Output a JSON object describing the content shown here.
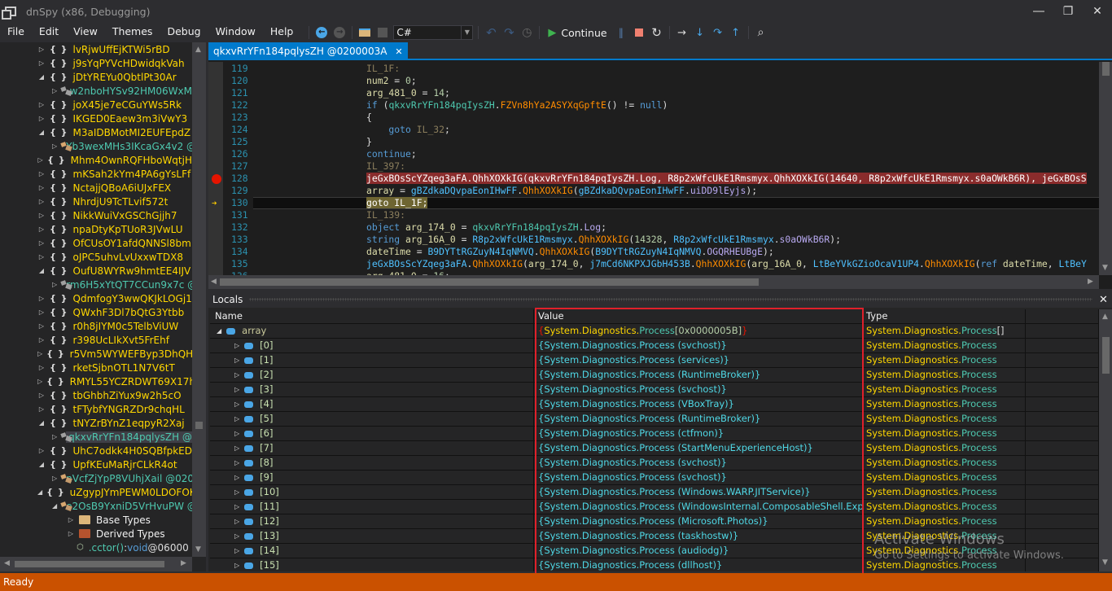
{
  "window": {
    "title": "dnSpy (x86, Debugging)",
    "controls": [
      "minimize",
      "restore",
      "close"
    ]
  },
  "menu": [
    "File",
    "Edit",
    "View",
    "Themes",
    "Debug",
    "Window",
    "Help"
  ],
  "toolbar": {
    "language": "C#",
    "continue_label": "Continue"
  },
  "tree": {
    "rows": [
      {
        "depth": 0,
        "kind": "ns",
        "expanded": false,
        "label": "lvRjwUffEjKTWi5rBD"
      },
      {
        "depth": 0,
        "kind": "ns",
        "expanded": false,
        "label": "j9sYqPYVcHDwidqkVah"
      },
      {
        "depth": 0,
        "kind": "ns",
        "expanded": true,
        "label": "jDtYREYu0QbtlPt30Ar"
      },
      {
        "depth": 1,
        "kind": "cls-gray",
        "expanded": false,
        "label": "w2nboHYSv92HM06WxM"
      },
      {
        "depth": 0,
        "kind": "ns",
        "expanded": false,
        "label": "joX45je7eCGuYWs5Rk"
      },
      {
        "depth": 0,
        "kind": "ns",
        "expanded": false,
        "label": "IKGED0Eaew3m3iVwY3"
      },
      {
        "depth": 0,
        "kind": "ns",
        "expanded": true,
        "label": "M3aIDBMotMI2EUFEpdZ"
      },
      {
        "depth": 1,
        "kind": "cls",
        "expanded": false,
        "label": "Yb3wexMHs3IKcaGx4v2 @"
      },
      {
        "depth": 0,
        "kind": "ns",
        "expanded": false,
        "label": "Mhm4OwnRQFHboWqtjH"
      },
      {
        "depth": 0,
        "kind": "ns",
        "expanded": false,
        "label": "mKSah2kYm4PA6gYsLFf"
      },
      {
        "depth": 0,
        "kind": "ns",
        "expanded": false,
        "label": "NctajjQBoA6iUJxFEX"
      },
      {
        "depth": 0,
        "kind": "ns",
        "expanded": false,
        "label": "NhrdjU9TcTLvif572t"
      },
      {
        "depth": 0,
        "kind": "ns",
        "expanded": false,
        "label": "NikkWuiVxGSChGjjh7"
      },
      {
        "depth": 0,
        "kind": "ns",
        "expanded": false,
        "label": "npaDtyKpTUoR3JVwLU"
      },
      {
        "depth": 0,
        "kind": "ns",
        "expanded": false,
        "label": "OfCUsOY1afdQNNSl8bm"
      },
      {
        "depth": 0,
        "kind": "ns",
        "expanded": false,
        "label": "oJPC5uhvLvUxxwTDX8"
      },
      {
        "depth": 0,
        "kind": "ns",
        "expanded": true,
        "label": "OufU8WYRw9hmtEE4IJV"
      },
      {
        "depth": 1,
        "kind": "cls-gray",
        "expanded": false,
        "label": "rm6H5xYtQT7CCun9x7c @"
      },
      {
        "depth": 0,
        "kind": "ns",
        "expanded": false,
        "label": "QdmfogY3wwQKJkLOGj1"
      },
      {
        "depth": 0,
        "kind": "ns",
        "expanded": false,
        "label": "QWxhF3Dl7bQtG3Ytbb"
      },
      {
        "depth": 0,
        "kind": "ns",
        "expanded": false,
        "label": "r0h8jIYM0c5TelbViUW"
      },
      {
        "depth": 0,
        "kind": "ns",
        "expanded": false,
        "label": "r398UcLIkXvt5FrEhf"
      },
      {
        "depth": 0,
        "kind": "ns",
        "expanded": false,
        "label": "r5Vm5WYWEFByp3DhQHr"
      },
      {
        "depth": 0,
        "kind": "ns",
        "expanded": false,
        "label": "rketSjbnOTL1N7V6tT"
      },
      {
        "depth": 0,
        "kind": "ns",
        "expanded": false,
        "label": "RMYL55YCZRDWT69X17h"
      },
      {
        "depth": 0,
        "kind": "ns",
        "expanded": false,
        "label": "tbGhbhZiYux9w2h5cO"
      },
      {
        "depth": 0,
        "kind": "ns",
        "expanded": false,
        "label": "tFTybfYNGRZDr9chqHL"
      },
      {
        "depth": 0,
        "kind": "ns",
        "expanded": true,
        "label": "tNYZrBYnZ1eqpyR2Xaj"
      },
      {
        "depth": 1,
        "kind": "cls-gray",
        "expanded": false,
        "selected": true,
        "label": "qkxvRrYFn184pqlysZH @0"
      },
      {
        "depth": 0,
        "kind": "ns",
        "expanded": false,
        "label": "UhC7odkk4H0SQBfpkED"
      },
      {
        "depth": 0,
        "kind": "ns",
        "expanded": true,
        "label": "UpfKEuMaRjrCLkR4ot"
      },
      {
        "depth": 1,
        "kind": "cls",
        "expanded": false,
        "label": "nVcfZjYpP8VUhjXail @020"
      },
      {
        "depth": 0,
        "kind": "ns",
        "expanded": true,
        "label": "uZgypJYmPEWM0LDOFOK"
      },
      {
        "depth": 1,
        "kind": "cls",
        "expanded": true,
        "label": "e2OsB9YxniD5VrHvuPW @"
      },
      {
        "depth": 2,
        "kind": "folder-base",
        "expanded": false,
        "label": "Base Types"
      },
      {
        "depth": 2,
        "kind": "folder-derived",
        "expanded": false,
        "label": "Derived Types"
      },
      {
        "depth": 2,
        "kind": "method",
        "label": ".cctor()",
        "suffix_sep": " : ",
        "ret": "void",
        "token": " @06000"
      }
    ]
  },
  "editor": {
    "tab_title": "qkxvRrYFn184pqlysZH @0200003A",
    "breakpoint_line": 128,
    "current_line": 130,
    "lines": [
      {
        "n": "119",
        "tokens": [
          [
            "lbl",
            "IL_1F:"
          ]
        ]
      },
      {
        "n": "120",
        "tokens": [
          [
            "var",
            "num2"
          ],
          [
            "pun",
            " = "
          ],
          [
            "num",
            "0"
          ],
          [
            "pun",
            ";"
          ]
        ]
      },
      {
        "n": "121",
        "tokens": [
          [
            "var",
            "arg_481_0"
          ],
          [
            "pun",
            " = "
          ],
          [
            "num",
            "14"
          ],
          [
            "pun",
            ";"
          ]
        ]
      },
      {
        "n": "122",
        "tokens": [
          [
            "kw",
            "if"
          ],
          [
            "pun",
            " ("
          ],
          [
            "typ",
            "qkxvRrYFn184pqIysZH"
          ],
          [
            "pun",
            "."
          ],
          [
            "meth",
            "FZVn8hYa2ASYXqGpftE"
          ],
          [
            "pun",
            "() != "
          ],
          [
            "kw",
            "null"
          ],
          [
            "pun",
            ")"
          ]
        ]
      },
      {
        "n": "123",
        "tokens": [
          [
            "pun",
            "{"
          ]
        ]
      },
      {
        "n": "124",
        "tokens": [
          [
            "kw",
            "    goto"
          ],
          [
            "lbl",
            " IL_32"
          ],
          [
            "pun",
            ";"
          ]
        ]
      },
      {
        "n": "125",
        "tokens": [
          [
            "pun",
            "}"
          ]
        ]
      },
      {
        "n": "126",
        "tokens": [
          [
            "kw",
            "continue"
          ],
          [
            "pun",
            ";"
          ]
        ]
      },
      {
        "n": "127",
        "tokens": [
          [
            "lbl",
            "IL_397:"
          ]
        ]
      },
      {
        "n": "128",
        "bp": true,
        "tokens": [
          [
            "bp",
            "jeGxBOsScYZqeg3aFA.QhhXOXkIG(qkxvRrYFn184pqIysZH.Log, R8p2xWfcUkE1Rmsmyx.QhhXOXkIG(14640, R8p2xWfcUkE1Rmsmyx.s0aOWkB6R), jeGxBOsS"
          ]
        ]
      },
      {
        "n": "129",
        "tokens": [
          [
            "var",
            "array"
          ],
          [
            "pun",
            " = "
          ],
          [
            "cls2",
            "gBZdkaDQvpaEonIHwFF"
          ],
          [
            "pun",
            "."
          ],
          [
            "meth",
            "QhhXOXkIG"
          ],
          [
            "pun",
            "("
          ],
          [
            "cls2",
            "gBZdkaDQvpaEonIHwFF"
          ],
          [
            "pun",
            "."
          ],
          [
            "fld",
            "uiDD9lEyjs"
          ],
          [
            "pun",
            ");"
          ]
        ]
      },
      {
        "n": "130",
        "ip": true,
        "tokens": [
          [
            "goto",
            "goto IL_1F;"
          ]
        ]
      },
      {
        "n": "131",
        "tokens": [
          [
            "lbl",
            "IL_139:"
          ]
        ]
      },
      {
        "n": "132",
        "tokens": [
          [
            "kw",
            "object"
          ],
          [
            "var",
            " arg_174_0"
          ],
          [
            "pun",
            " = "
          ],
          [
            "typ",
            "qkxvRrYFn184pqIysZH"
          ],
          [
            "pun",
            "."
          ],
          [
            "fld",
            "Log"
          ],
          [
            "pun",
            ";"
          ]
        ]
      },
      {
        "n": "133",
        "tokens": [
          [
            "kw",
            "string"
          ],
          [
            "var",
            " arg_16A_0"
          ],
          [
            "pun",
            " = "
          ],
          [
            "cls2",
            "R8p2xWfcUkE1Rmsmyx"
          ],
          [
            "pun",
            "."
          ],
          [
            "meth",
            "QhhXOXkIG"
          ],
          [
            "pun",
            "("
          ],
          [
            "num",
            "14328"
          ],
          [
            "pun",
            ", "
          ],
          [
            "cls2",
            "R8p2xWfcUkE1Rmsmyx"
          ],
          [
            "pun",
            "."
          ],
          [
            "fld",
            "s0aOWkB6R"
          ],
          [
            "pun",
            ");"
          ]
        ]
      },
      {
        "n": "134",
        "tokens": [
          [
            "var",
            "dateTime"
          ],
          [
            "pun",
            " = "
          ],
          [
            "cls2",
            "B9DYTtRGZuyN4IqNMVQ"
          ],
          [
            "pun",
            "."
          ],
          [
            "meth",
            "QhhXOXkIG"
          ],
          [
            "pun",
            "("
          ],
          [
            "cls2",
            "B9DYTtRGZuyN4IqNMVQ"
          ],
          [
            "pun",
            "."
          ],
          [
            "fld",
            "OGQRHEUBgE"
          ],
          [
            "pun",
            ");"
          ]
        ]
      },
      {
        "n": "135",
        "tokens": [
          [
            "cls2",
            "jeGxBOsScYZqeg3aFA"
          ],
          [
            "pun",
            "."
          ],
          [
            "meth",
            "QhhXOXkIG"
          ],
          [
            "pun",
            "("
          ],
          [
            "var",
            "arg_174_0"
          ],
          [
            "pun",
            ", "
          ],
          [
            "cls2",
            "j7mCd6NKPXJGbH453B"
          ],
          [
            "pun",
            "."
          ],
          [
            "meth",
            "QhhXOXkIG"
          ],
          [
            "pun",
            "("
          ],
          [
            "var",
            "arg_16A_0"
          ],
          [
            "pun",
            ", "
          ],
          [
            "cls2",
            "LtBeYVkGZioOcaV1UP4"
          ],
          [
            "pun",
            "."
          ],
          [
            "meth",
            "QhhXOXkIG"
          ],
          [
            "pun",
            "("
          ],
          [
            "kw",
            "ref"
          ],
          [
            "var",
            " dateTime"
          ],
          [
            "pun",
            ", "
          ],
          [
            "cls2",
            "LtBeY"
          ]
        ]
      },
      {
        "n": "136",
        "tokens": [
          [
            "var",
            "arg_481_0"
          ],
          [
            "pun",
            " = "
          ],
          [
            "num",
            "16"
          ],
          [
            "pun",
            ";"
          ]
        ]
      }
    ]
  },
  "locals": {
    "title": "Locals",
    "columns": [
      "Name",
      "Value",
      "Type"
    ],
    "root": {
      "name": "array",
      "value_prefix": "System.Diagnostics.",
      "value_cls": "Process",
      "value_idx": "[0x0000005B]",
      "type_ns": "System.Diagnostics.",
      "type_cls": "Process",
      "type_suffix": "[]"
    },
    "item_type_ns": "System.Diagnostics.",
    "item_type_cls": "Process",
    "items": [
      {
        "name": "[0]",
        "value": "{System.Diagnostics.Process (svchost)}"
      },
      {
        "name": "[1]",
        "value": "{System.Diagnostics.Process (services)}"
      },
      {
        "name": "[2]",
        "value": "{System.Diagnostics.Process (RuntimeBroker)}"
      },
      {
        "name": "[3]",
        "value": "{System.Diagnostics.Process (svchost)}"
      },
      {
        "name": "[4]",
        "value": "{System.Diagnostics.Process (VBoxTray)}"
      },
      {
        "name": "[5]",
        "value": "{System.Diagnostics.Process (RuntimeBroker)}"
      },
      {
        "name": "[6]",
        "value": "{System.Diagnostics.Process (ctfmon)}"
      },
      {
        "name": "[7]",
        "value": "{System.Diagnostics.Process (StartMenuExperienceHost)}"
      },
      {
        "name": "[8]",
        "value": "{System.Diagnostics.Process (svchost)}"
      },
      {
        "name": "[9]",
        "value": "{System.Diagnostics.Process (svchost)}"
      },
      {
        "name": "[10]",
        "value": "{System.Diagnostics.Process (Windows.WARP.JITService)}"
      },
      {
        "name": "[11]",
        "value": "{System.Diagnostics.Process (WindowsInternal.ComposableShell.Experie..."
      },
      {
        "name": "[12]",
        "value": "{System.Diagnostics.Process (Microsoft.Photos)}"
      },
      {
        "name": "[13]",
        "value": "{System.Diagnostics.Process (taskhostw)}"
      },
      {
        "name": "[14]",
        "value": "{System.Diagnostics.Process (audiodg)}"
      },
      {
        "name": "[15]",
        "value": "{System.Diagnostics.Process (dllhost)}"
      }
    ]
  },
  "watermark": {
    "line1": "Activate Windows",
    "line2": "Go to Settings to activate Windows."
  },
  "status": "Ready",
  "colors": {
    "accent": "#007acc",
    "status_bar": "#ca5100",
    "breakpoint": "#e51400",
    "highlight_box": "#e0202a"
  }
}
